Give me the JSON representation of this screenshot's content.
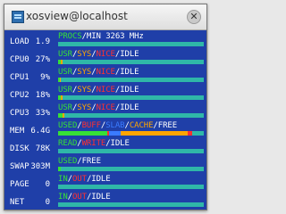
{
  "window": {
    "title": "xosview@localhost",
    "close_glyph": "✕",
    "app_icon": "xosview-icon"
  },
  "meters": [
    {
      "label": "LOAD",
      "value": "1.9",
      "legend": [
        {
          "text": "PROCS",
          "color": "#37e037"
        },
        {
          "text": "/",
          "color": "#ffffff"
        },
        {
          "text": "MIN 3263 MHz",
          "color": "#ffffff"
        }
      ],
      "bar": [
        {
          "fraction": 1.0,
          "color": "#2fb7a8"
        }
      ]
    },
    {
      "label": "CPU0",
      "value": "27%",
      "legend": [
        {
          "text": "USR",
          "color": "#37e037"
        },
        {
          "text": "/",
          "color": "#ffffff"
        },
        {
          "text": "SYS",
          "color": "#ffa500"
        },
        {
          "text": "/",
          "color": "#ffffff"
        },
        {
          "text": "NICE",
          "color": "#ff3030"
        },
        {
          "text": "/",
          "color": "#ffffff"
        },
        {
          "text": "IDLE",
          "color": "#ffffff"
        }
      ],
      "bar": [
        {
          "fraction": 0.02,
          "color": "#37e037"
        },
        {
          "fraction": 0.01,
          "color": "#ffa500"
        },
        {
          "fraction": 0.97,
          "color": "#2fb7a8"
        }
      ]
    },
    {
      "label": "CPU1",
      "value": "9%",
      "legend": [
        {
          "text": "USR",
          "color": "#37e037"
        },
        {
          "text": "/",
          "color": "#ffffff"
        },
        {
          "text": "SYS",
          "color": "#ffa500"
        },
        {
          "text": "/",
          "color": "#ffffff"
        },
        {
          "text": "NICE",
          "color": "#ff3030"
        },
        {
          "text": "/",
          "color": "#ffffff"
        },
        {
          "text": "IDLE",
          "color": "#ffffff"
        }
      ],
      "bar": [
        {
          "fraction": 0.01,
          "color": "#37e037"
        },
        {
          "fraction": 0.01,
          "color": "#ffa500"
        },
        {
          "fraction": 0.98,
          "color": "#2fb7a8"
        }
      ]
    },
    {
      "label": "CPU2",
      "value": "18%",
      "legend": [
        {
          "text": "USR",
          "color": "#37e037"
        },
        {
          "text": "/",
          "color": "#ffffff"
        },
        {
          "text": "SYS",
          "color": "#ffa500"
        },
        {
          "text": "/",
          "color": "#ffffff"
        },
        {
          "text": "NICE",
          "color": "#ff3030"
        },
        {
          "text": "/",
          "color": "#ffffff"
        },
        {
          "text": "IDLE",
          "color": "#ffffff"
        }
      ],
      "bar": [
        {
          "fraction": 0.02,
          "color": "#37e037"
        },
        {
          "fraction": 0.01,
          "color": "#ffa500"
        },
        {
          "fraction": 0.97,
          "color": "#2fb7a8"
        }
      ]
    },
    {
      "label": "CPU3",
      "value": "33%",
      "legend": [
        {
          "text": "USR",
          "color": "#37e037"
        },
        {
          "text": "/",
          "color": "#ffffff"
        },
        {
          "text": "SYS",
          "color": "#ffa500"
        },
        {
          "text": "/",
          "color": "#ffffff"
        },
        {
          "text": "NICE",
          "color": "#ff3030"
        },
        {
          "text": "/",
          "color": "#ffffff"
        },
        {
          "text": "IDLE",
          "color": "#ffffff"
        }
      ],
      "bar": [
        {
          "fraction": 0.03,
          "color": "#37e037"
        },
        {
          "fraction": 0.01,
          "color": "#ffa500"
        },
        {
          "fraction": 0.96,
          "color": "#2fb7a8"
        }
      ]
    },
    {
      "label": "MEM",
      "value": "6.4G",
      "legend": [
        {
          "text": "USED",
          "color": "#37e037"
        },
        {
          "text": "/",
          "color": "#ffffff"
        },
        {
          "text": "BUFF",
          "color": "#ff3030"
        },
        {
          "text": "/",
          "color": "#ffffff"
        },
        {
          "text": "SLAB",
          "color": "#3a7bff"
        },
        {
          "text": "/",
          "color": "#ffffff"
        },
        {
          "text": "CACHE",
          "color": "#ffa500"
        },
        {
          "text": "/",
          "color": "#ffffff"
        },
        {
          "text": "FREE",
          "color": "#ffffff"
        }
      ],
      "bar": [
        {
          "fraction": 0.34,
          "color": "#37e037"
        },
        {
          "fraction": 0.01,
          "color": "#ff3030"
        },
        {
          "fraction": 0.08,
          "color": "#3a7bff"
        },
        {
          "fraction": 0.46,
          "color": "#ffa500"
        },
        {
          "fraction": 0.03,
          "color": "#ff3030"
        },
        {
          "fraction": 0.08,
          "color": "#2fb7a8"
        }
      ]
    },
    {
      "label": "DISK",
      "value": "78K",
      "legend": [
        {
          "text": "READ",
          "color": "#37e037"
        },
        {
          "text": "/",
          "color": "#ffffff"
        },
        {
          "text": "WRITE",
          "color": "#ff3030"
        },
        {
          "text": "/",
          "color": "#ffffff"
        },
        {
          "text": "IDLE",
          "color": "#ffffff"
        }
      ],
      "bar": [
        {
          "fraction": 1.0,
          "color": "#2fb7a8"
        }
      ]
    },
    {
      "label": "SWAP",
      "value": "303M",
      "legend": [
        {
          "text": "USED",
          "color": "#37e037"
        },
        {
          "text": "/",
          "color": "#ffffff"
        },
        {
          "text": "FREE",
          "color": "#ffffff"
        }
      ],
      "bar": [
        {
          "fraction": 0.02,
          "color": "#37e037"
        },
        {
          "fraction": 0.98,
          "color": "#2fb7a8"
        }
      ]
    },
    {
      "label": "PAGE",
      "value": "0",
      "legend": [
        {
          "text": "IN",
          "color": "#37e037"
        },
        {
          "text": "/",
          "color": "#ffffff"
        },
        {
          "text": "OUT",
          "color": "#ff3030"
        },
        {
          "text": "/",
          "color": "#ffffff"
        },
        {
          "text": "IDLE",
          "color": "#ffffff"
        }
      ],
      "bar": [
        {
          "fraction": 1.0,
          "color": "#2fb7a8"
        }
      ]
    },
    {
      "label": "NET",
      "value": "0",
      "legend": [
        {
          "text": "IN",
          "color": "#37e037"
        },
        {
          "text": "/",
          "color": "#ffffff"
        },
        {
          "text": "OUT",
          "color": "#ff3030"
        },
        {
          "text": "/",
          "color": "#ffffff"
        },
        {
          "text": "IDLE",
          "color": "#ffffff"
        }
      ],
      "bar": [
        {
          "fraction": 1.0,
          "color": "#2fb7a8"
        }
      ]
    }
  ]
}
